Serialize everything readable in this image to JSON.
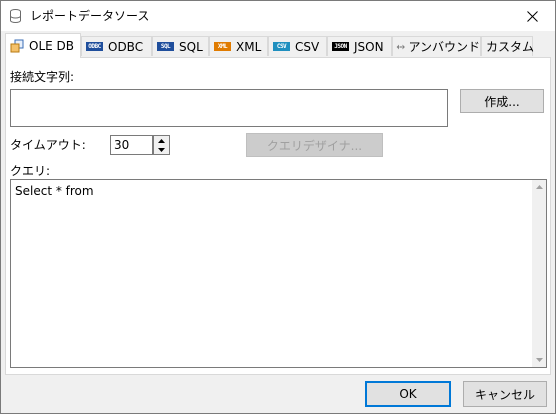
{
  "window": {
    "title": "レポートデータソース"
  },
  "tabs": [
    {
      "label": "OLE DB",
      "icon": "ole-db-icon",
      "active": true
    },
    {
      "label": "ODBC",
      "icon": "odbc-icon",
      "icon_text": "ODBC"
    },
    {
      "label": "SQL",
      "icon": "sql-icon",
      "icon_text": "SQL"
    },
    {
      "label": "XML",
      "icon": "xml-icon",
      "icon_text": "XML"
    },
    {
      "label": "CSV",
      "icon": "csv-icon",
      "icon_text": "CSV"
    },
    {
      "label": "JSON",
      "icon": "json-icon",
      "icon_text": "JSON"
    },
    {
      "label": "アンバウンド",
      "icon": "unbound-icon"
    },
    {
      "label": "カスタム"
    }
  ],
  "panel": {
    "connection_label": "接続文字列:",
    "connection_value": "",
    "create_button": "作成...",
    "timeout_label": "タイムアウト:",
    "timeout_value": "30",
    "query_designer_button": "クエリデザイナ...",
    "query_label": "クエリ:",
    "query_value": "Select * from"
  },
  "footer": {
    "ok_label": "OK",
    "cancel_label": "キャンセル"
  },
  "colors": {
    "accent": "#0078d7",
    "window_bg": "#f0f0f0",
    "panel_bg": "#ffffff",
    "odbc_icon": "#1f4e9c",
    "sql_icon": "#1f4e9c",
    "xml_icon": "#e07b00",
    "csv_icon": "#1f8fbf",
    "json_icon": "#000000"
  }
}
